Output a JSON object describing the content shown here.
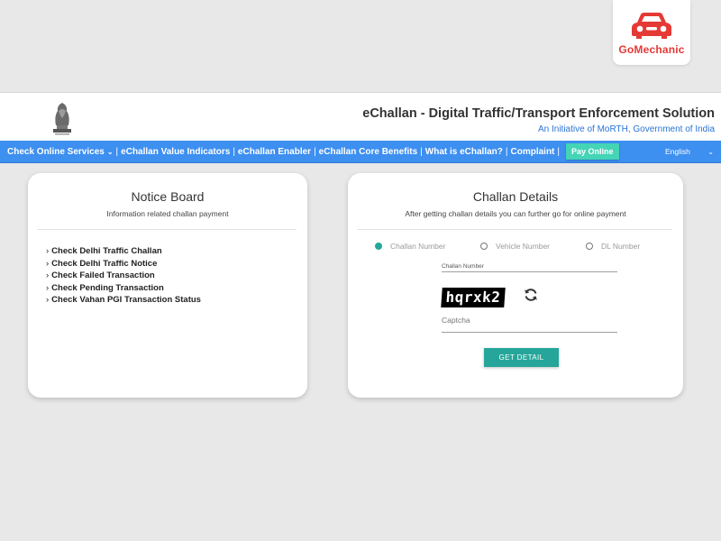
{
  "brand": {
    "name": "GoMechanic",
    "color": "#e53935",
    "icon": "car-icon"
  },
  "header": {
    "title": "eChallan - Digital Traffic/Transport Enforcement Solution",
    "subtitle": "An Initiative of MoRTH, Government of India",
    "emblem": "national-emblem-icon"
  },
  "nav": {
    "items": [
      "Check Online Services",
      "eChallan Value Indicators",
      "eChallan Enabler",
      "eChallan Core Benefits",
      "What is eChallan?",
      "Complaint"
    ],
    "pay_button": "Pay Online",
    "language": "English",
    "bar_color": "#3d8ff0"
  },
  "notice_board": {
    "title": "Notice Board",
    "subtitle": "Information related challan payment",
    "links": [
      "Check Delhi Traffic Challan",
      "Check Delhi Traffic Notice",
      "Check Failed Transaction",
      "Check Pending Transaction",
      "Check Vahan PGI Transaction Status"
    ]
  },
  "challan_details": {
    "title": "Challan Details",
    "subtitle": "After getting challan details you can further go for online payment",
    "options": [
      "Challan Number",
      "Vehicle Number",
      "DL Number"
    ],
    "selected_option": "Challan Number",
    "challan_field_label": "Challan Number",
    "challan_value": "",
    "captcha_text": "hqrxk2",
    "captcha_label": "Captcha",
    "captcha_value": "",
    "submit_label": "GET DETAIL",
    "accent": "#26a69a"
  }
}
